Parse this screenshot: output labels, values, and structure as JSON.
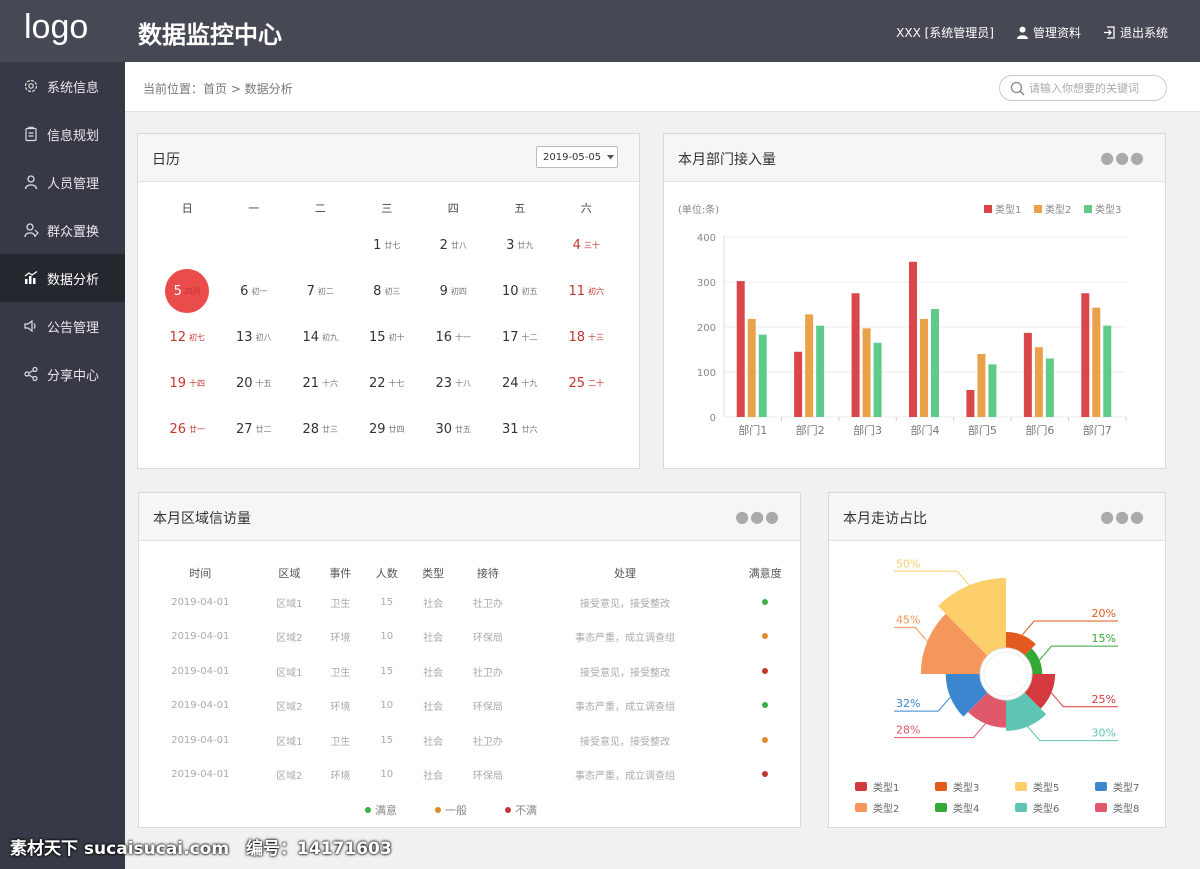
{
  "header": {
    "logo": "logo",
    "title": "数据监控中心",
    "user": "XXX [系统管理员]",
    "profile": "管理资料",
    "logout": "退出系统"
  },
  "sidebar": {
    "items": [
      {
        "label": "系统信息",
        "icon": "gear-icon"
      },
      {
        "label": "信息规划",
        "icon": "clipboard-icon"
      },
      {
        "label": "人员管理",
        "icon": "user-icon"
      },
      {
        "label": "群众置换",
        "icon": "user-swap-icon"
      },
      {
        "label": "数据分析",
        "icon": "bar-chart-icon",
        "active": true
      },
      {
        "label": "公告管理",
        "icon": "speaker-icon"
      },
      {
        "label": "分享中心",
        "icon": "share-icon"
      }
    ]
  },
  "breadcrumb": "当前位置：首页 > 数据分析",
  "search": {
    "placeholder": "请输入你想要的关键词"
  },
  "calendar": {
    "title": "日历",
    "date": "2019-05-05",
    "weekdays": [
      "日",
      "一",
      "二",
      "三",
      "四",
      "五",
      "六"
    ],
    "weeks": [
      [
        null,
        null,
        null,
        {
          "d": "1",
          "l": "廿七"
        },
        {
          "d": "2",
          "l": "廿八"
        },
        {
          "d": "3",
          "l": "廿九"
        },
        {
          "d": "4",
          "l": "三十"
        }
      ],
      [
        {
          "d": "5",
          "l": "四月",
          "today": true
        },
        {
          "d": "6",
          "l": "初一"
        },
        {
          "d": "7",
          "l": "初二"
        },
        {
          "d": "8",
          "l": "初三"
        },
        {
          "d": "9",
          "l": "初四"
        },
        {
          "d": "10",
          "l": "初五"
        },
        {
          "d": "11",
          "l": "初六"
        }
      ],
      [
        {
          "d": "12",
          "l": "初七"
        },
        {
          "d": "13",
          "l": "初八"
        },
        {
          "d": "14",
          "l": "初九"
        },
        {
          "d": "15",
          "l": "初十"
        },
        {
          "d": "16",
          "l": "十一"
        },
        {
          "d": "17",
          "l": "十二"
        },
        {
          "d": "18",
          "l": "十三"
        }
      ],
      [
        {
          "d": "19",
          "l": "十四"
        },
        {
          "d": "20",
          "l": "十五"
        },
        {
          "d": "21",
          "l": "十六"
        },
        {
          "d": "22",
          "l": "十七"
        },
        {
          "d": "23",
          "l": "十八"
        },
        {
          "d": "24",
          "l": "十九"
        },
        {
          "d": "25",
          "l": "二十"
        }
      ],
      [
        {
          "d": "26",
          "l": "廿一"
        },
        {
          "d": "27",
          "l": "廿二"
        },
        {
          "d": "28",
          "l": "廿三"
        },
        {
          "d": "29",
          "l": "廿四"
        },
        {
          "d": "30",
          "l": "廿五"
        },
        {
          "d": "31",
          "l": "廿六"
        },
        null
      ]
    ]
  },
  "bar_panel": {
    "title": "本月部门接入量"
  },
  "table_panel": {
    "title": "本月区域信访量",
    "columns": [
      "时间",
      "区域",
      "事件",
      "人数",
      "类型",
      "接待",
      "处理",
      "满意度"
    ],
    "rows": [
      [
        "2019-04-01",
        "区域1",
        "卫生",
        "15",
        "社会",
        "社卫办",
        "接受意见，接受整改",
        "满意"
      ],
      [
        "2019-04-01",
        "区域2",
        "环境",
        "10",
        "社会",
        "环保局",
        "事态严重，成立调查组",
        "一般"
      ],
      [
        "2019-04-01",
        "区域1",
        "卫生",
        "15",
        "社会",
        "社卫办",
        "接受意见，接受整改",
        "不满"
      ],
      [
        "2019-04-01",
        "区域2",
        "环境",
        "10",
        "社会",
        "环保局",
        "事态严重，成立调查组",
        "满意"
      ],
      [
        "2019-04-01",
        "区域1",
        "卫生",
        "15",
        "社会",
        "社卫办",
        "接受意见，接受整改",
        "一般"
      ],
      [
        "2019-04-01",
        "区域2",
        "环境",
        "10",
        "社会",
        "环保局",
        "事态严重，成立调查组",
        "不满"
      ]
    ],
    "legend": [
      {
        "label": "满意",
        "color": "#3cb043"
      },
      {
        "label": "一般",
        "color": "#e08b2e"
      },
      {
        "label": "不满",
        "color": "#c23531"
      }
    ]
  },
  "pie_panel": {
    "title": "本月走访占比"
  },
  "chart_data": [
    {
      "type": "bar",
      "ylabel": "(单位:条)",
      "categories": [
        "部门1",
        "部门2",
        "部门3",
        "部门4",
        "部门5",
        "部门6",
        "部门7"
      ],
      "ylim": [
        0,
        400
      ],
      "yticks": [
        "0",
        "100",
        "200",
        "300",
        "400"
      ],
      "legend_position": "top-right",
      "series": [
        {
          "name": "类型1",
          "color": "#d9474a",
          "values": [
            302,
            145,
            275,
            345,
            60,
            187,
            275
          ]
        },
        {
          "name": "类型2",
          "color": "#e9a24a",
          "values": [
            218,
            228,
            197,
            218,
            140,
            155,
            243
          ]
        },
        {
          "name": "类型3",
          "color": "#5fcb8b",
          "values": [
            183,
            203,
            165,
            240,
            117,
            130,
            203
          ]
        }
      ]
    },
    {
      "type": "pie",
      "variant": "rose",
      "labels": [
        "类型1",
        "类型2",
        "类型3",
        "类型4",
        "类型5",
        "类型6",
        "类型7",
        "类型8"
      ],
      "colors": [
        "#d3393d",
        "#f5965a",
        "#e35a1e",
        "#34a836",
        "#fccf6b",
        "#5ec4b4",
        "#3b86cf",
        "#e0596b"
      ],
      "slices": [
        {
          "series": "类型3",
          "value": 20,
          "label": "20%"
        },
        {
          "series": "类型4",
          "value": 15,
          "label": "15%"
        },
        {
          "series": "类型1",
          "value": 25,
          "label": "25%"
        },
        {
          "series": "类型6",
          "value": 30,
          "label": "30%"
        },
        {
          "series": "类型8",
          "value": 28,
          "label": "28%"
        },
        {
          "series": "类型7",
          "value": 32,
          "label": "32%"
        },
        {
          "series": "类型2",
          "value": 45,
          "label": "45%"
        },
        {
          "series": "类型5",
          "value": 50,
          "label": "50%"
        }
      ]
    }
  ]
}
